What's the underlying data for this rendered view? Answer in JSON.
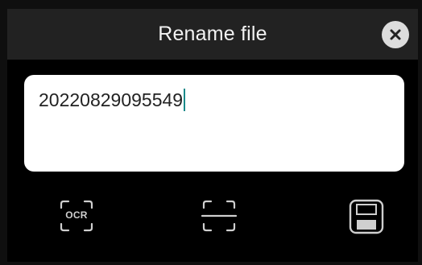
{
  "dialog": {
    "title": "Rename file",
    "close_icon": "close-icon"
  },
  "filename_field": {
    "value": "20220829095549"
  },
  "toolbar": {
    "ocr_label": "OCR",
    "ocr_icon": "ocr-scan-icon",
    "scan_icon": "scan-frame-icon",
    "save_icon": "save-icon"
  },
  "colors": {
    "header_bg": "#222222",
    "dialog_bg": "#000000",
    "caret": "#1a8a8a",
    "icon": "#cfcfcf"
  }
}
